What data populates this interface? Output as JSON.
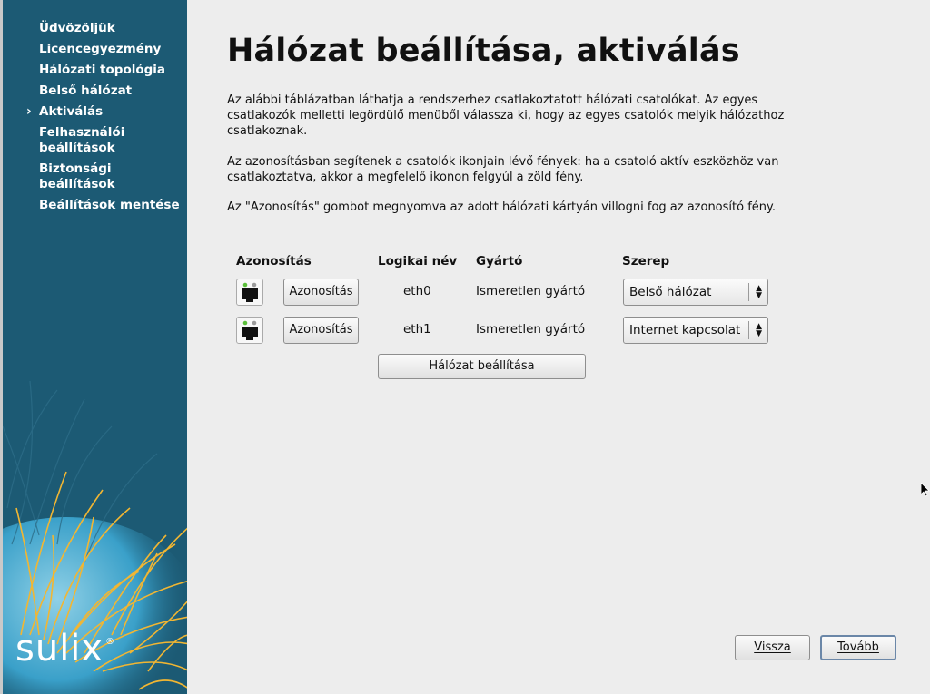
{
  "sidebar": {
    "items": [
      {
        "label": "Üdvözöljük",
        "current": false
      },
      {
        "label": "Licencegyezmény",
        "current": false
      },
      {
        "label": "Hálózati topológia",
        "current": false
      },
      {
        "label": "Belső hálózat",
        "current": false
      },
      {
        "label": "Aktiválás",
        "current": true
      },
      {
        "label": "Felhasználói beállítások",
        "current": false
      },
      {
        "label": "Biztonsági beállítások",
        "current": false
      },
      {
        "label": "Beállítások mentése",
        "current": false
      }
    ],
    "logo_text": "sulix",
    "logo_mark": "®"
  },
  "main": {
    "title": "Hálózat beállítása, aktiválás",
    "paragraphs": [
      "Az alábbi táblázatban láthatja a rendszerhez csatlakoztatott hálózati csatolókat. Az egyes csatlakozók melletti legördülő menüből válassza ki, hogy az egyes csatolók melyik hálózathoz csatlakoznak.",
      "Az azonosításban segítenek a csatolók ikonjain lévő fények: ha a csatoló aktív eszközhöz van csatlakoztatva, akkor a megfelelő ikonon felgyúl a zöld fény.",
      "Az \"Azonosítás\" gombot megnyomva az adott hálózati kártyán villogni fog az azonosító fény."
    ],
    "table": {
      "headers": {
        "identify": "Azonosítás",
        "name": "Logikai név",
        "vendor": "Gyártó",
        "role": "Szerep"
      },
      "rows": [
        {
          "identify_label": "Azonosítás",
          "name": "eth0",
          "vendor": "Ismeretlen gyártó",
          "role": "Belső hálózat",
          "icon": "network-port-icon"
        },
        {
          "identify_label": "Azonosítás",
          "name": "eth1",
          "vendor": "Ismeretlen gyártó",
          "role": "Internet kapcsolat",
          "icon": "network-port-icon"
        }
      ]
    },
    "configure_button": "Hálózat beállítása"
  },
  "footer": {
    "back_label": "Vissza",
    "next_label": "Tovább"
  },
  "colors": {
    "sidebar_bg": "#1c5a74",
    "background": "#ededed",
    "grass_yellow": "#f2b632",
    "led_green": "#5bbf3a"
  }
}
